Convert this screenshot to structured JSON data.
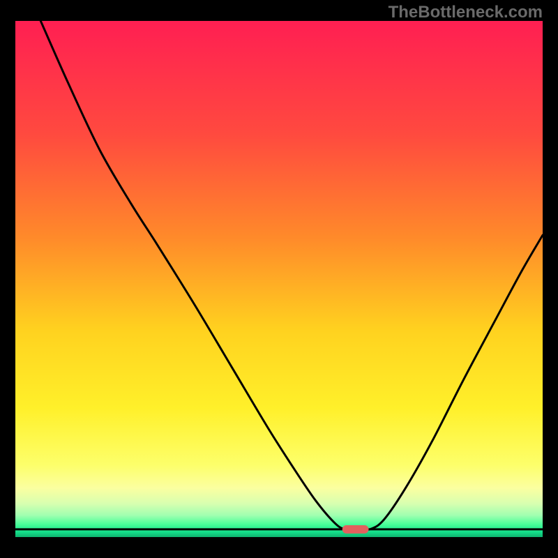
{
  "watermark": "TheBottleneck.com",
  "chart_data": {
    "type": "line",
    "title": "",
    "xlabel": "",
    "ylabel": "",
    "xlim": [
      0,
      100
    ],
    "ylim": [
      0,
      100
    ],
    "gradient_stops": [
      {
        "offset": 0.0,
        "color": "#ff1f52"
      },
      {
        "offset": 0.22,
        "color": "#ff4a3f"
      },
      {
        "offset": 0.42,
        "color": "#ff8a2a"
      },
      {
        "offset": 0.6,
        "color": "#ffd21f"
      },
      {
        "offset": 0.75,
        "color": "#fff02a"
      },
      {
        "offset": 0.86,
        "color": "#fdff6a"
      },
      {
        "offset": 0.905,
        "color": "#fbffa0"
      },
      {
        "offset": 0.935,
        "color": "#d8ffb0"
      },
      {
        "offset": 0.958,
        "color": "#a0ffb0"
      },
      {
        "offset": 0.975,
        "color": "#4aff9a"
      },
      {
        "offset": 0.99,
        "color": "#13e08a"
      },
      {
        "offset": 1.0,
        "color": "#0fb36f"
      }
    ],
    "curve": [
      {
        "x": 4.8,
        "y": 100.0
      },
      {
        "x": 10.0,
        "y": 88.0
      },
      {
        "x": 16.0,
        "y": 75.0
      },
      {
        "x": 22.0,
        "y": 64.5
      },
      {
        "x": 27.0,
        "y": 56.5
      },
      {
        "x": 34.0,
        "y": 45.0
      },
      {
        "x": 41.0,
        "y": 33.0
      },
      {
        "x": 48.0,
        "y": 21.0
      },
      {
        "x": 53.0,
        "y": 13.0
      },
      {
        "x": 57.0,
        "y": 7.0
      },
      {
        "x": 60.5,
        "y": 2.8
      },
      {
        "x": 62.5,
        "y": 1.5
      },
      {
        "x": 65.0,
        "y": 1.5
      },
      {
        "x": 67.5,
        "y": 1.6
      },
      {
        "x": 70.0,
        "y": 3.5
      },
      {
        "x": 74.0,
        "y": 9.5
      },
      {
        "x": 79.0,
        "y": 18.5
      },
      {
        "x": 85.0,
        "y": 30.5
      },
      {
        "x": 91.0,
        "y": 42.0
      },
      {
        "x": 96.0,
        "y": 51.5
      },
      {
        "x": 100.0,
        "y": 58.5
      }
    ],
    "marker": {
      "x": 64.5,
      "y": 1.5,
      "w": 5.0,
      "h": 1.6,
      "color": "#e2605e"
    },
    "baseline_y": 1.5,
    "stroke": "#000000",
    "stroke_width": 3
  }
}
